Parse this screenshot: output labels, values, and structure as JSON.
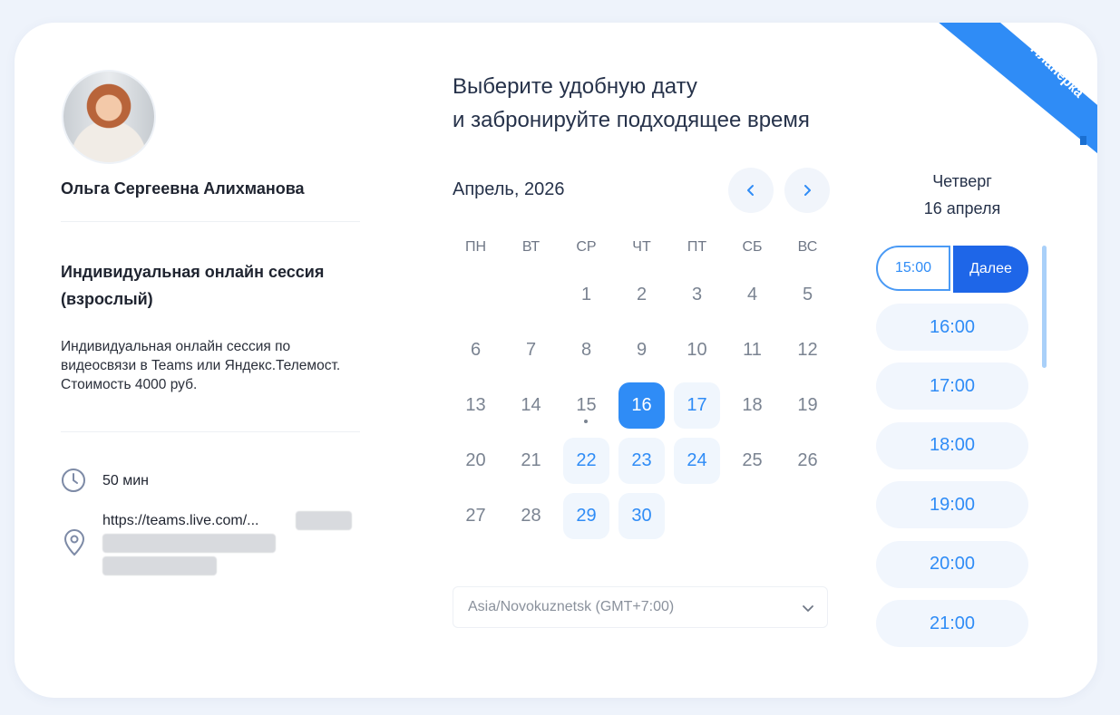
{
  "ribbon": {
    "line1": "На платформе",
    "line2": "Планёрка"
  },
  "specialist": {
    "name": "Ольга Сергеевна Алихманова"
  },
  "service": {
    "title": "Индивидуальная онлайн сессия (взрослый)",
    "description": "Индивидуальная онлайн сессия по видеосвязи в Teams или Яндекс.Телемост. Стоимость 4000 руб.",
    "duration": "50 мин",
    "location": "https://teams.live.com/..."
  },
  "heading": {
    "line1": "Выберите удобную дату",
    "line2": "и забронируйте подходящее время"
  },
  "calendar": {
    "month_label": "Апрель, 2026",
    "prev_icon": "chevron-left-icon",
    "next_icon": "chevron-right-icon",
    "weekdays": [
      "ПН",
      "ВТ",
      "СР",
      "ЧТ",
      "ПТ",
      "СБ",
      "ВС"
    ],
    "leading_blanks": 2,
    "days": [
      {
        "d": "1",
        "s": "normal"
      },
      {
        "d": "2",
        "s": "normal"
      },
      {
        "d": "3",
        "s": "normal"
      },
      {
        "d": "4",
        "s": "normal"
      },
      {
        "d": "5",
        "s": "normal"
      },
      {
        "d": "6",
        "s": "normal"
      },
      {
        "d": "7",
        "s": "normal"
      },
      {
        "d": "8",
        "s": "normal"
      },
      {
        "d": "9",
        "s": "normal"
      },
      {
        "d": "10",
        "s": "normal"
      },
      {
        "d": "11",
        "s": "normal"
      },
      {
        "d": "12",
        "s": "normal"
      },
      {
        "d": "13",
        "s": "normal"
      },
      {
        "d": "14",
        "s": "normal"
      },
      {
        "d": "15",
        "s": "today"
      },
      {
        "d": "16",
        "s": "selected"
      },
      {
        "d": "17",
        "s": "available"
      },
      {
        "d": "18",
        "s": "normal"
      },
      {
        "d": "19",
        "s": "normal"
      },
      {
        "d": "20",
        "s": "normal"
      },
      {
        "d": "21",
        "s": "normal"
      },
      {
        "d": "22",
        "s": "available"
      },
      {
        "d": "23",
        "s": "available"
      },
      {
        "d": "24",
        "s": "available"
      },
      {
        "d": "25",
        "s": "normal"
      },
      {
        "d": "26",
        "s": "normal"
      },
      {
        "d": "27",
        "s": "normal"
      },
      {
        "d": "28",
        "s": "normal"
      },
      {
        "d": "29",
        "s": "available"
      },
      {
        "d": "30",
        "s": "available"
      }
    ]
  },
  "timezone": {
    "value": "Asia/Novokuznetsk (GMT+7:00)"
  },
  "selected_day": {
    "weekday": "Четверг",
    "date": "16 апреля"
  },
  "times": {
    "selected": "15:00",
    "next_label": "Далее",
    "slots": [
      "16:00",
      "17:00",
      "18:00",
      "19:00",
      "20:00",
      "21:00"
    ]
  },
  "colors": {
    "accent": "#2f8cf6",
    "next_button": "#1e66e8",
    "available_bg": "#f0f6fd"
  }
}
